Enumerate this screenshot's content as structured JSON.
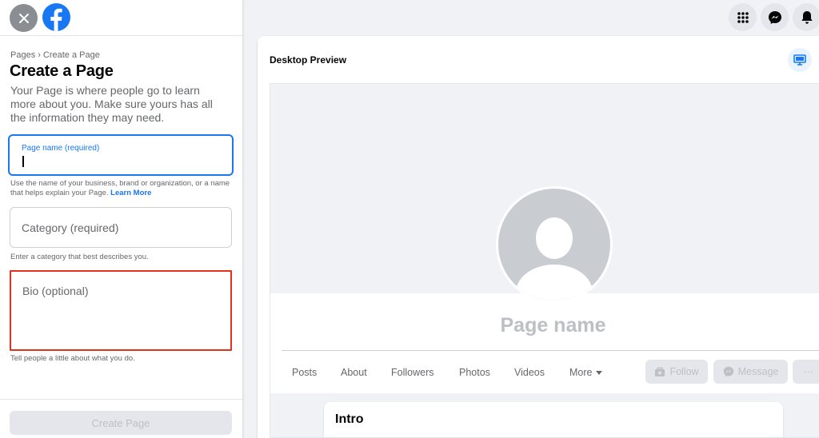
{
  "breadcrumb": {
    "root": "Pages",
    "separator": "›",
    "current": "Create a Page"
  },
  "title": "Create a Page",
  "description": "Your Page is where people go to learn more about you. Make sure yours has all the information they may need.",
  "form": {
    "page_name": {
      "label": "Page name (required)",
      "value": "",
      "help": "Use the name of your business, brand or organization, or a name that helps explain your Page.",
      "help_link": "Learn More"
    },
    "category": {
      "placeholder": "Category (required)",
      "help": "Enter a category that best describes you."
    },
    "bio": {
      "placeholder": "Bio (optional)",
      "help": "Tell people a little about what you do."
    },
    "submit_label": "Create Page"
  },
  "top_icons": [
    "menu-grid-icon",
    "messenger-icon",
    "notifications-bell-icon"
  ],
  "preview": {
    "title": "Desktop Preview",
    "page_name": "Page name",
    "tabs": [
      "Posts",
      "About",
      "Followers",
      "Photos",
      "Videos",
      "More"
    ],
    "actions": {
      "follow": "Follow",
      "message": "Message",
      "more": "···"
    },
    "intro_title": "Intro"
  },
  "colors": {
    "brand_blue": "#1877f2",
    "highlight_red": "#e0321c",
    "secondary_text": "#65676b",
    "disabled": "#bcc0c4"
  }
}
